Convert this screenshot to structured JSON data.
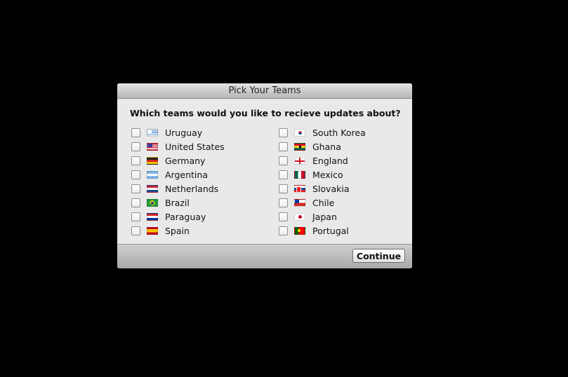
{
  "dialog": {
    "title": "Pick Your Teams",
    "question": "Which teams would you like to recieve updates about?",
    "continue_label": "Continue"
  },
  "teams_left": [
    {
      "label": "Uruguay",
      "flag": "uruguay-flag-icon",
      "checked": false
    },
    {
      "label": "United States",
      "flag": "us-flag-icon",
      "checked": false
    },
    {
      "label": "Germany",
      "flag": "germany-flag-icon",
      "checked": false
    },
    {
      "label": "Argentina",
      "flag": "argentina-flag-icon",
      "checked": false
    },
    {
      "label": "Netherlands",
      "flag": "netherlands-flag-icon",
      "checked": false
    },
    {
      "label": "Brazil",
      "flag": "brazil-flag-icon",
      "checked": false
    },
    {
      "label": "Paraguay",
      "flag": "paraguay-flag-icon",
      "checked": false
    },
    {
      "label": "Spain",
      "flag": "spain-flag-icon",
      "checked": false
    }
  ],
  "teams_right": [
    {
      "label": "South Korea",
      "flag": "south-korea-flag-icon",
      "checked": false
    },
    {
      "label": "Ghana",
      "flag": "ghana-flag-icon",
      "checked": false
    },
    {
      "label": "England",
      "flag": "england-flag-icon",
      "checked": false
    },
    {
      "label": "Mexico",
      "flag": "mexico-flag-icon",
      "checked": false
    },
    {
      "label": "Slovakia",
      "flag": "slovakia-flag-icon",
      "checked": false
    },
    {
      "label": "Chile",
      "flag": "chile-flag-icon",
      "checked": false
    },
    {
      "label": "Japan",
      "flag": "japan-flag-icon",
      "checked": false
    },
    {
      "label": "Portugal",
      "flag": "portugal-flag-icon",
      "checked": false
    }
  ]
}
